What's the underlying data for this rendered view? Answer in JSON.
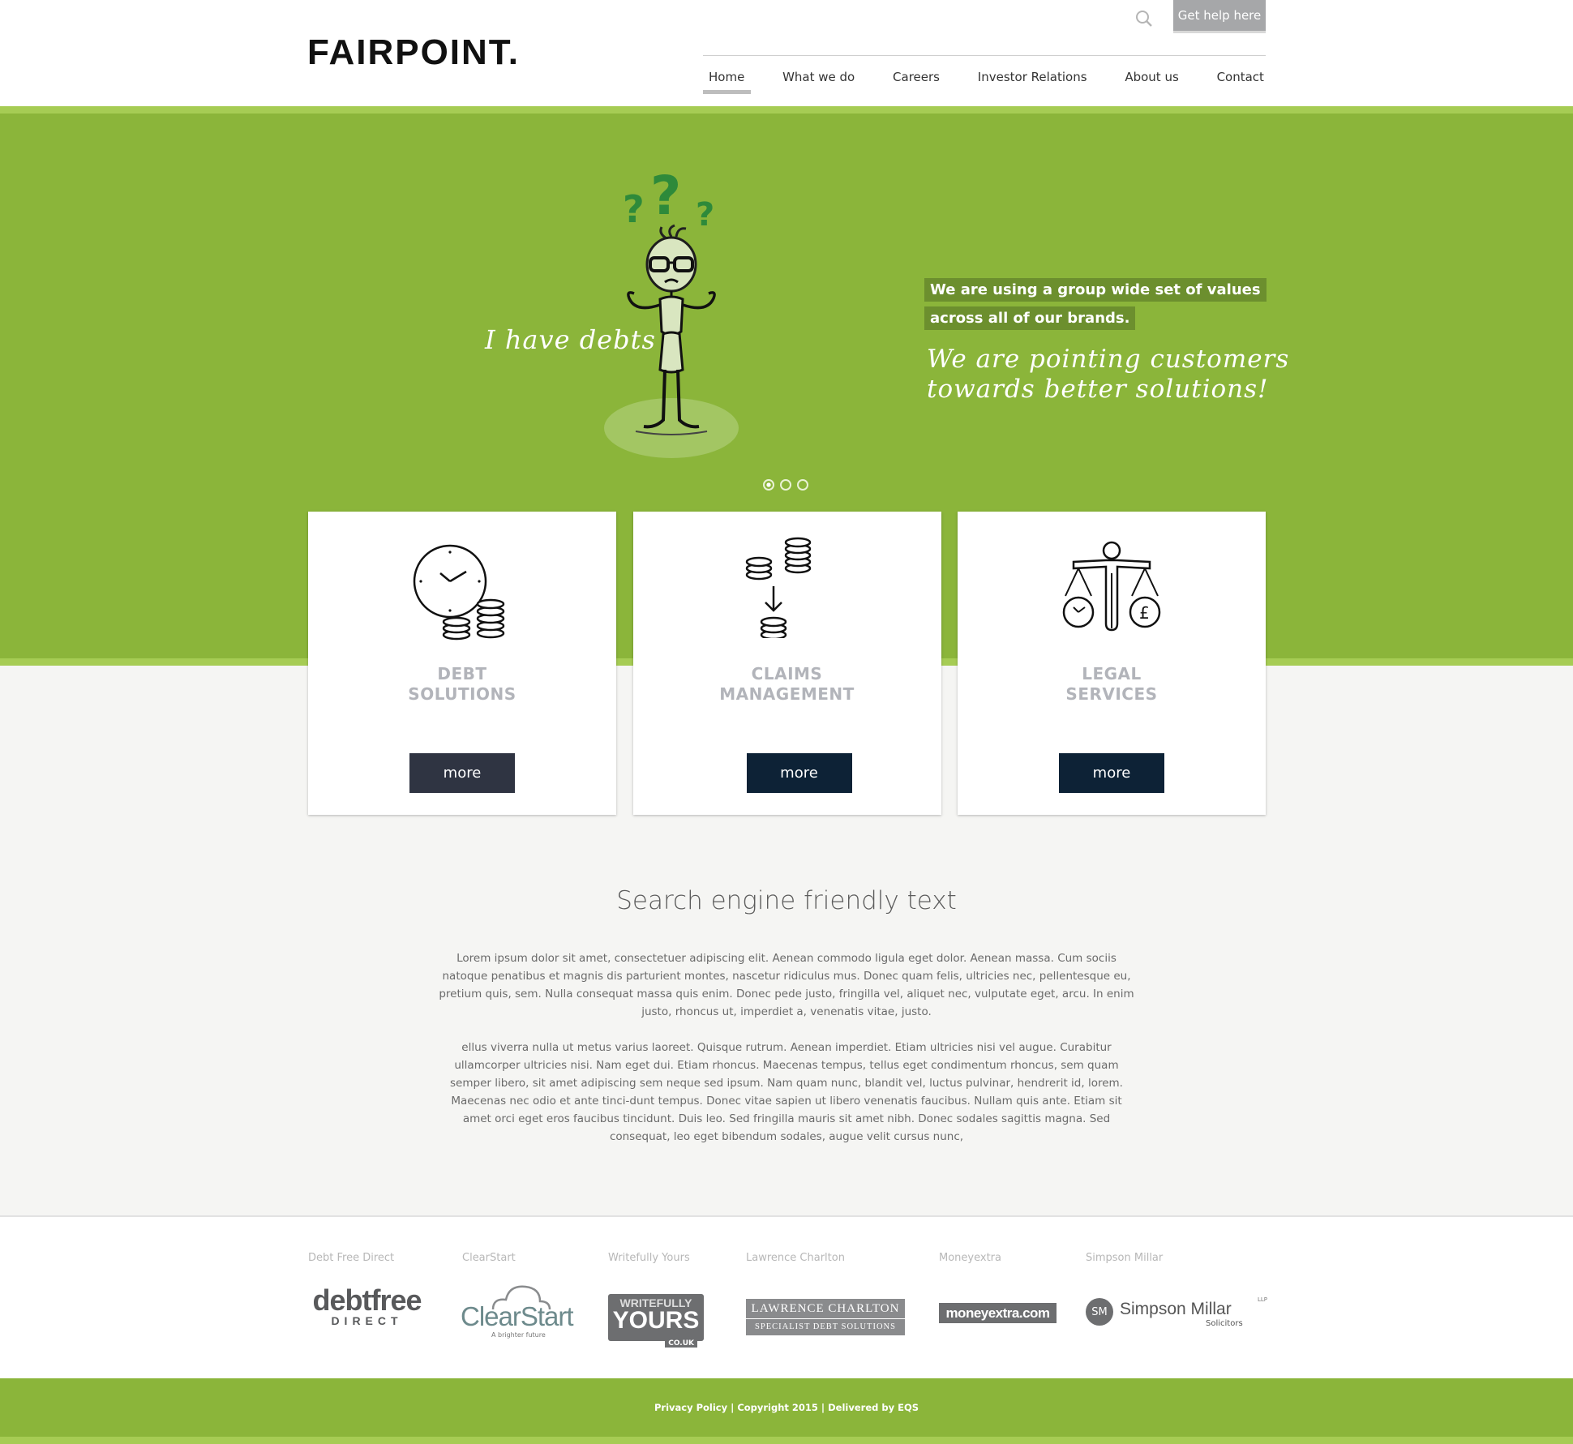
{
  "header": {
    "logo": "FAIRPOINT.",
    "help_button": "Get help here",
    "nav": [
      "Home",
      "What we do",
      "Careers",
      "Investor Relations",
      "About us",
      "Contact"
    ],
    "active_nav": "Home"
  },
  "hero": {
    "left_handwriting": "I have debts",
    "tag_line_1": "We are using a group wide set of values",
    "tag_line_2": "across all of our brands.",
    "right_handwriting_1": "We are pointing customers",
    "right_handwriting_2": "towards better solutions!",
    "slides": 3,
    "active_slide": 1
  },
  "cards": [
    {
      "title_1": "DEBT",
      "title_2": "SOLUTIONS",
      "button": "more",
      "icon": "clock-coins-icon",
      "button_color": "#2f3442"
    },
    {
      "title_1": "CLAIMS",
      "title_2": "MANAGEMENT",
      "button": "more",
      "icon": "coins-transfer-icon",
      "button_color": "#0d2236"
    },
    {
      "title_1": "LEGAL",
      "title_2": "SERVICES",
      "button": "more",
      "icon": "scales-icon",
      "button_color": "#0d2236"
    }
  ],
  "content": {
    "title": "Search engine friendly text",
    "p1": "Lorem ipsum dolor sit amet, consectetuer adipiscing elit. Aenean commodo ligula eget dolor. Aenean massa. Cum sociis natoque penatibus et magnis dis parturient montes, nascetur ridiculus mus. Donec quam felis, ultricies nec, pellentesque eu, pretium quis, sem. Nulla consequat massa quis enim. Donec pede justo, fringilla vel, aliquet nec, vulputate eget, arcu. In enim justo, rhoncus ut, imperdiet a, venenatis vitae, justo.",
    "p2": "ellus viverra nulla ut metus varius laoreet. Quisque rutrum. Aenean imperdiet. Etiam ultricies nisi vel augue. Curabitur ullamcorper ultricies nisi. Nam eget dui. Etiam rhoncus. Maecenas tempus, tellus eget condimentum rhoncus, sem quam semper libero, sit amet adipiscing sem neque sed ipsum. Nam quam nunc, blandit vel, luctus pulvinar, hendrerit id, lorem. Maecenas nec odio et ante tinci-dunt tempus. Donec vitae sapien ut libero venenatis faucibus. Nullam quis ante. Etiam sit amet orci eget eros faucibus tincidunt. Duis leo. Sed fringilla mauris sit amet nibh. Donec sodales sagittis magna. Sed consequat, leo eget bibendum sodales, augue velit cursus nunc,"
  },
  "brands": [
    {
      "label": "Debt Free Direct",
      "logo_main": "debtfree",
      "logo_sub": "DIRECT"
    },
    {
      "label": "ClearStart",
      "logo_main": "ClearStart",
      "logo_sub": "A brighter future"
    },
    {
      "label": "Writefully Yours",
      "logo_main": "YOURS",
      "logo_top": "WRITEFULLY",
      "logo_sub": "CO.UK"
    },
    {
      "label": "Lawrence Charlton",
      "logo_main": "LAWRENCE CHARLTON",
      "logo_sub": "SPECIALIST DEBT SOLUTIONS"
    },
    {
      "label": "Moneyextra",
      "logo_main": "moneyextra.com"
    },
    {
      "label": "Simpson Millar",
      "logo_main": "Simpson Millar",
      "logo_sub": "Solicitors",
      "logo_mark": "SM",
      "logo_sup": "LLP"
    }
  ],
  "footer": {
    "text": "Privacy Policy | Copyright 2015 |  Delivered by EQS"
  },
  "colors": {
    "green": "#8bb53a",
    "light_green": "#a6cc54",
    "dark_green_tag": "#6c8f2e",
    "navy": "#0d2236"
  }
}
